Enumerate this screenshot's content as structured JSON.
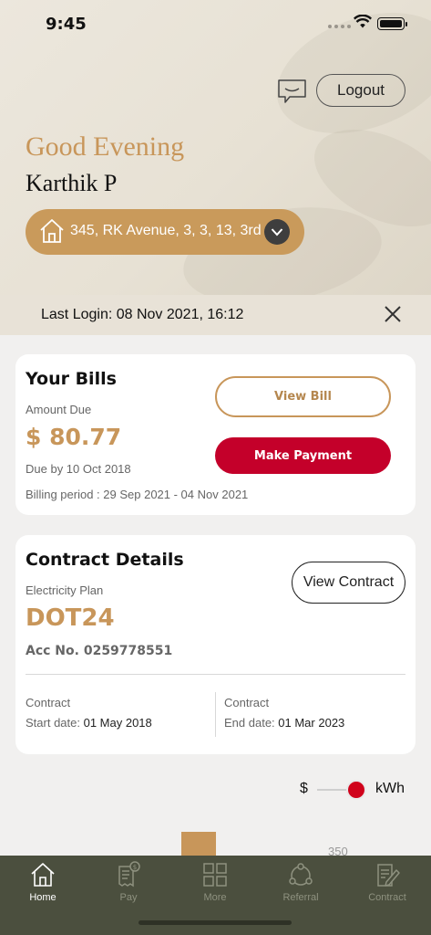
{
  "status_bar": {
    "time": "9:45"
  },
  "header": {
    "logout_label": "Logout",
    "greeting": "Good Evening",
    "user_name": "Karthik P",
    "address": "345, RK Avenue, 3, 3, 13, 3rd",
    "colors": {
      "accent": "#c8965a",
      "dark_chip": "#3e3e3e"
    }
  },
  "last_login": {
    "text": "Last Login: 08 Nov 2021, 16:12"
  },
  "bills": {
    "title": "Your Bills",
    "amount_label": "Amount Due",
    "amount": "$ 80.77",
    "due_text": "Due by 10 Oct 2018",
    "billing_period": "Billing period : 29 Sep 2021 - 04 Nov 2021",
    "view_bill_label": "View Bill",
    "make_payment_label": "Make Payment",
    "colors": {
      "pay_button": "#c4002a"
    }
  },
  "contract": {
    "title": "Contract Details",
    "plan_label": "Electricity Plan",
    "plan_name": "DOT24",
    "acc_no": "Acc No. 0259778551",
    "view_contract_label": "View Contract",
    "start_label": "Contract",
    "start_prefix": "Start date:",
    "start_date": "01 May 2018",
    "end_label": "Contract",
    "end_prefix": "End date:",
    "end_date": "01 Mar 2023"
  },
  "usage_toggle": {
    "left_label": "$",
    "right_label": "kWh",
    "selected": "kWh"
  },
  "chart_peek": {
    "label": "350"
  },
  "nav": {
    "items": [
      {
        "label": "Home",
        "icon": "home-icon",
        "active": true
      },
      {
        "label": "Pay",
        "icon": "pay-icon",
        "active": false
      },
      {
        "label": "More",
        "icon": "grid-icon",
        "active": false
      },
      {
        "label": "Referral",
        "icon": "referral-icon",
        "active": false
      },
      {
        "label": "Contract",
        "icon": "contract-icon",
        "active": false
      }
    ]
  }
}
